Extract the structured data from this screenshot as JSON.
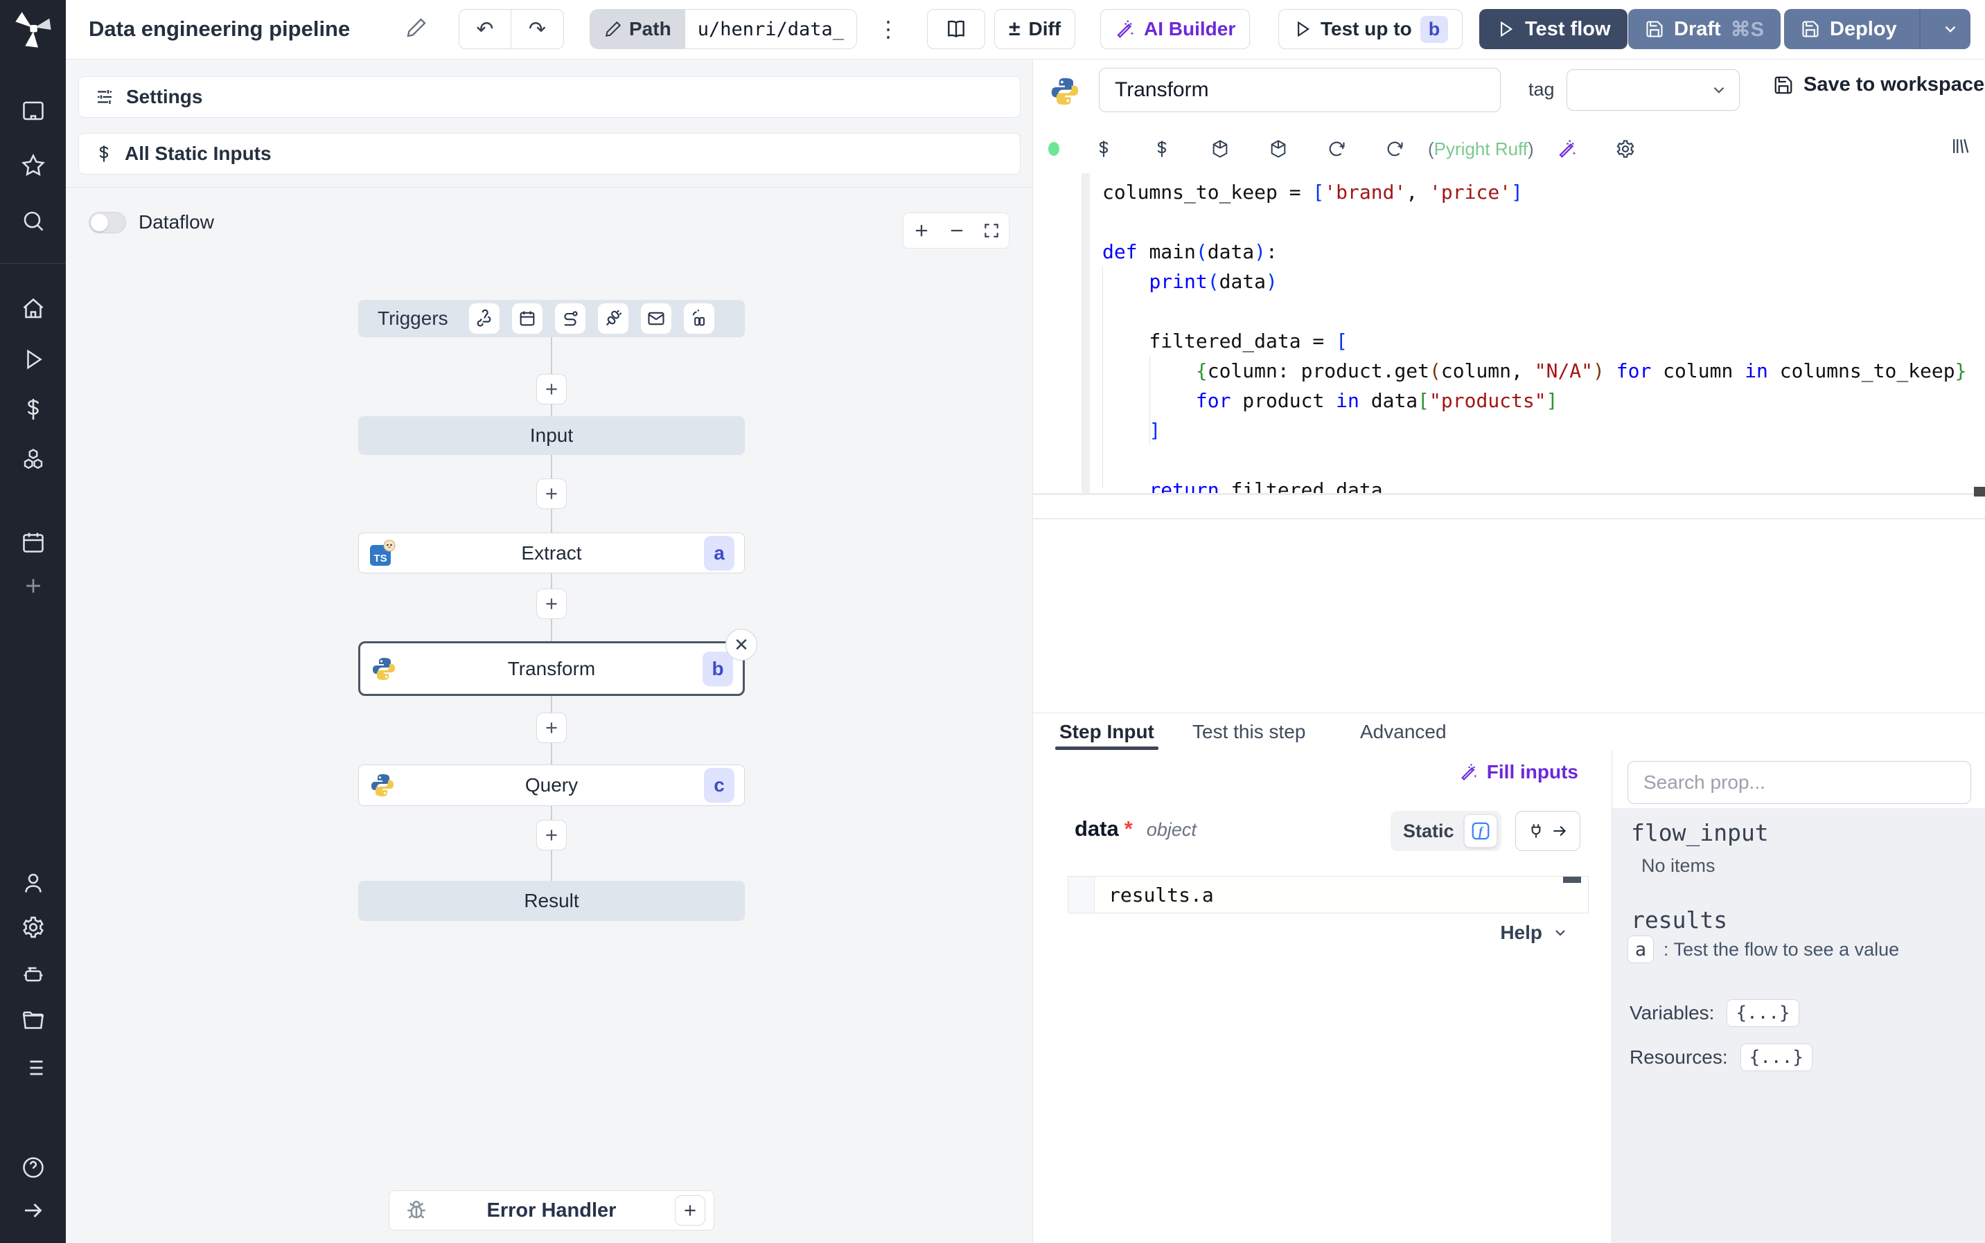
{
  "colors": {
    "sidebar_bg": "#20242e",
    "canvas_bg": "#f4f5f6",
    "node_virtual": "#dfe5ec",
    "accent_purple": "#6d28d9",
    "testflow_navy": "#3d4a66",
    "deploy_slate": "#64799f",
    "badge_bg": "#dfe3fd",
    "badge_text": "#3f4cc5",
    "lint_green": "#79c98d",
    "selected_border": "#4b5563"
  },
  "topbar": {
    "title": "Data engineering pipeline",
    "undo": "↶",
    "redo": "↷",
    "path_label": "Path",
    "path_value": "u/henri/data_",
    "kebab": "⋮",
    "diff_label": "Diff",
    "diff_icon": "±",
    "ai_builder_label": "AI Builder",
    "test_upto_label": "Test up to",
    "test_upto_badge": "b",
    "testflow_label": "Test flow",
    "draft_label": "Draft",
    "draft_shortcut": "⌘S",
    "deploy_label": "Deploy"
  },
  "sidebar": {
    "icons": [
      "windmill-logo",
      "workspace",
      "favorites-star",
      "search",
      "home",
      "runs-play",
      "variables-dollar",
      "resources-cubes",
      "schedules-calendar",
      "add-plus",
      "user",
      "settings-gear",
      "workers-robot",
      "folders",
      "audit-list",
      "help",
      "expand-arrow"
    ]
  },
  "canvas": {
    "settings_label": "Settings",
    "static_inputs_label": "All Static Inputs",
    "dataflow_label": "Dataflow",
    "triggers_label": "Triggers",
    "trigger_icons": [
      "webhook",
      "schedule-calendar",
      "route",
      "plug",
      "email",
      "watch"
    ],
    "input_label": "Input",
    "result_label": "Result",
    "error_handler_label": "Error Handler",
    "nodes": [
      {
        "label": "Extract",
        "badge": "a",
        "lang": "typescript-bun"
      },
      {
        "label": "Transform",
        "badge": "b",
        "lang": "python",
        "selected": true
      },
      {
        "label": "Query",
        "badge": "c",
        "lang": "python"
      }
    ]
  },
  "editor": {
    "step_name": "Transform",
    "tag_label": "tag",
    "save_label": "Save to workspace",
    "lint_label": "Pyright Ruff",
    "toolbar_icons": [
      "status-dot",
      "dollar-static",
      "dollar-static",
      "package",
      "package",
      "refresh",
      "refresh",
      "lint",
      "ai-wand",
      "gear",
      "library"
    ],
    "code": {
      "lines": [
        [
          [
            "columns_to_keep = ",
            "p"
          ],
          [
            "[",
            "b1"
          ],
          [
            "'brand'",
            "s"
          ],
          [
            ", ",
            "p"
          ],
          [
            "'price'",
            "s"
          ],
          [
            "]",
            "b1"
          ]
        ],
        [],
        [
          [
            "def ",
            "k"
          ],
          [
            "main",
            "p"
          ],
          [
            "(",
            "b1"
          ],
          [
            "data",
            "p"
          ],
          [
            ")",
            "b1"
          ],
          [
            ":",
            "p"
          ]
        ],
        [
          [
            "    ",
            "p"
          ],
          [
            "print",
            "k"
          ],
          [
            "(",
            "b1"
          ],
          [
            "data",
            "p"
          ],
          [
            ")",
            "b1"
          ]
        ],
        [],
        [
          [
            "    filtered_data = ",
            "p"
          ],
          [
            "[",
            "b1"
          ]
        ],
        [
          [
            "        ",
            "p"
          ],
          [
            "{",
            "b2"
          ],
          [
            "column: product.get",
            "p"
          ],
          [
            "(",
            "b3"
          ],
          [
            "column, ",
            "p"
          ],
          [
            "\"N/A\"",
            "s"
          ],
          [
            ")",
            "b3"
          ],
          [
            " ",
            "p"
          ],
          [
            "for",
            "k"
          ],
          [
            " column ",
            "p"
          ],
          [
            "in",
            "k"
          ],
          [
            " columns_to_keep",
            "p"
          ],
          [
            "}",
            "b2"
          ]
        ],
        [
          [
            "        ",
            "p"
          ],
          [
            "for",
            "k"
          ],
          [
            " product ",
            "p"
          ],
          [
            "in",
            "k"
          ],
          [
            " data",
            "p"
          ],
          [
            "[",
            "b2"
          ],
          [
            "\"products\"",
            "s"
          ],
          [
            "]",
            "b2"
          ]
        ],
        [
          [
            "    ",
            "p"
          ],
          [
            "]",
            "b1"
          ]
        ],
        [],
        [
          [
            "    ",
            "p"
          ],
          [
            "return",
            "k"
          ],
          [
            " filtered_data",
            "p"
          ]
        ]
      ]
    }
  },
  "tabs": {
    "items": [
      {
        "label": "Step Input"
      },
      {
        "label": "Test this step"
      },
      {
        "label": "Advanced"
      }
    ],
    "active": 0
  },
  "step_input": {
    "fill_inputs_label": "Fill inputs",
    "field_name": "data",
    "required_mark": "*",
    "field_type": "object",
    "static_label": "Static",
    "expr_value": "results.a",
    "help_label": "Help"
  },
  "props_panel": {
    "search_placeholder": "Search prop...",
    "flow_input_title": "flow_input",
    "flow_input_empty": "No items",
    "results_title": "results",
    "result_key": "a",
    "result_hint": ":  Test the flow to see a value",
    "variables_label": "Variables:",
    "variables_value": "{...}",
    "resources_label": "Resources:",
    "resources_value": "{...}"
  }
}
